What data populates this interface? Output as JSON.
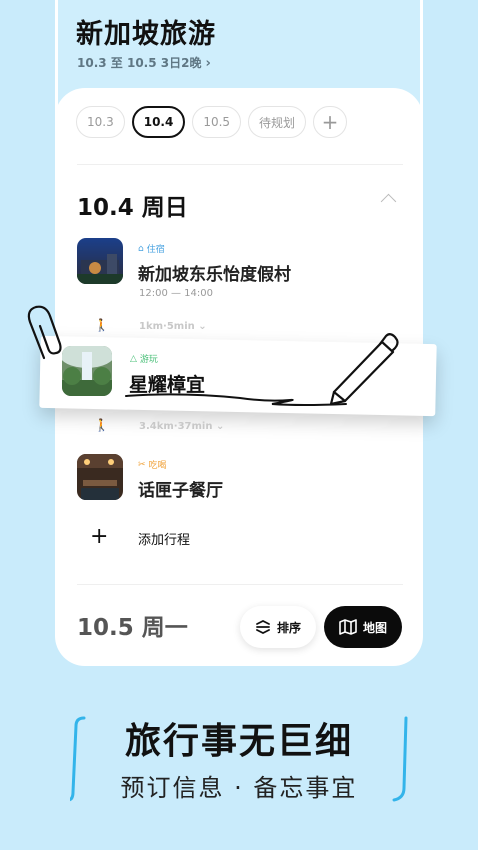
{
  "trip": {
    "title": "新加坡旅游",
    "subtitle": "10.3 至 10.5   3日2晚"
  },
  "date_tabs": [
    "10.3",
    "10.4",
    "10.5",
    "待规划"
  ],
  "day": {
    "heading": "10.4 周日",
    "items": [
      {
        "tag": "住宿",
        "name": "新加坡东乐怡度假村",
        "time": "12:00 — 14:00",
        "tag_color": "#4aa3e0"
      },
      {
        "walk": "1km·5min"
      },
      {
        "tag": "游玩",
        "name": "星耀樟宜",
        "tag_color": "#4cc07a"
      },
      {
        "walk": "3.4km·37min"
      },
      {
        "tag": "吃喝",
        "name": "话匣子餐厅",
        "tag_color": "#f0a23a"
      }
    ],
    "add_label": "添加行程"
  },
  "next_day": {
    "heading": "10.5 周一"
  },
  "buttons": {
    "sort": "排序",
    "map": "地图"
  },
  "slogan": {
    "title": "旅行事无巨细",
    "subtitle": "预订信息 · 备忘事宜"
  },
  "colors": {
    "background": "#c9ebfb",
    "accent_blue": "#33b4ea"
  }
}
